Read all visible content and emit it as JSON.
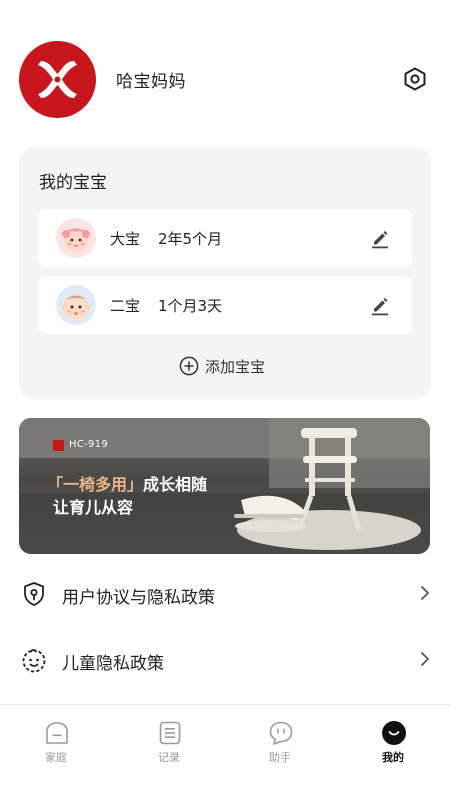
{
  "user": {
    "name": "哈宝妈妈",
    "avatar_color": "#c8161d"
  },
  "babies_card": {
    "title": "我的宝宝",
    "babies": [
      {
        "name": "大宝",
        "age": "2年5个月",
        "avatar": "girl-baby-avatar"
      },
      {
        "name": "二宝",
        "age": "1个月3天",
        "avatar": "boy-baby-avatar"
      }
    ],
    "add_label": "添加宝宝"
  },
  "banner": {
    "model": "HC-919",
    "tagline_highlight": "「一椅多用」",
    "tagline_rest": "成长相随",
    "tagline2": "让育儿从容",
    "highlight_color": "#e8b58a"
  },
  "menu": [
    {
      "label": "用户协议与隐私政策",
      "icon": "shield-icon"
    },
    {
      "label": "儿童隐私政策",
      "icon": "child-face-icon"
    }
  ],
  "tabs": [
    {
      "label": "家庭",
      "icon": "home-icon",
      "active": false
    },
    {
      "label": "记录",
      "icon": "record-icon",
      "active": false
    },
    {
      "label": "助手",
      "icon": "chat-icon",
      "active": false
    },
    {
      "label": "我的",
      "icon": "profile-icon",
      "active": true
    }
  ]
}
